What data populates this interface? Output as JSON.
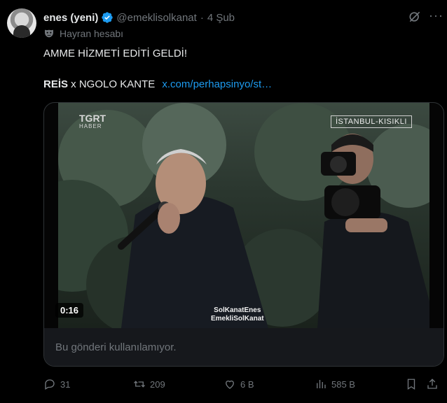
{
  "tweet": {
    "display_name": "enes (yeni)",
    "handle": "@emeklisolkanat",
    "separator": "·",
    "date": "4 Şub",
    "label": "Hayran hesabı",
    "text_line1": "AMME HİZMETİ EDİTİ GELDİ!",
    "text_bold": "REİS",
    "text_rest": " x NGOLO KANTE",
    "link": "x.com/perhapsinyo/st…",
    "more_label": "···"
  },
  "media": {
    "channel": "TGRT",
    "channel_sub": "HABER",
    "location_badge": "İSTANBUL-KISIKLI",
    "watermark_line1": "SolKanatEnes",
    "watermark_line2": "EmekliSolKanat",
    "duration": "0:16",
    "unavailable_text": "Bu gönderi kullanılamıyor."
  },
  "actions": {
    "replies": "31",
    "reposts": "209",
    "likes": "6 B",
    "views": "585 B"
  },
  "colors": {
    "background": "#000000",
    "link": "#1d9bf0",
    "muted": "#71767b",
    "verified": "#1d9bf0"
  },
  "icons": [
    "verified-icon",
    "grok-icon",
    "fan-mask-icon",
    "reply-icon",
    "repost-icon",
    "like-icon",
    "views-icon",
    "bookmark-icon",
    "share-icon"
  ]
}
